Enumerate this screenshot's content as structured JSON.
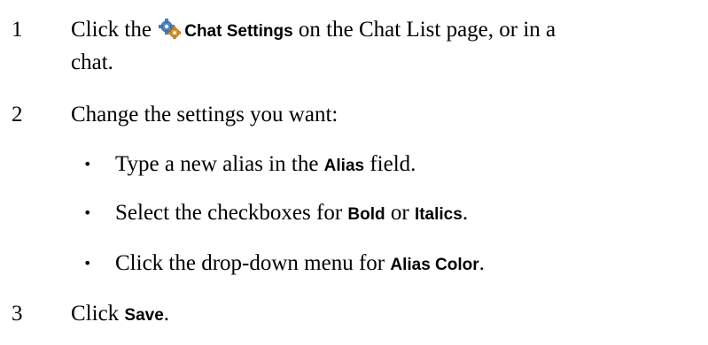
{
  "steps": [
    {
      "number": "1",
      "text_before": "Click the ",
      "ui_label": "Chat Settings",
      "text_after": " on the Chat List page, or in a",
      "continuation": "chat.",
      "icon": "gear-icon"
    },
    {
      "number": "2",
      "text": "Change the settings you want:",
      "bullets": [
        {
          "before": "Type a new alias in the ",
          "ui1": "Alias",
          "after": " field."
        },
        {
          "before": "Select the checkboxes for ",
          "ui1": "Bold",
          "middle": " or ",
          "ui2": "Italics",
          "after": "."
        },
        {
          "before": "Click the drop-down menu for ",
          "ui1": "Alias Color",
          "after": "."
        }
      ]
    },
    {
      "number": "3",
      "text_before": "Click ",
      "ui_label": "Save",
      "text_after": "."
    }
  ],
  "bullet_glyph": "•",
  "colors": {
    "text": "#000000",
    "icon_blue": "#4f86c6",
    "icon_orange": "#e89a2a"
  }
}
